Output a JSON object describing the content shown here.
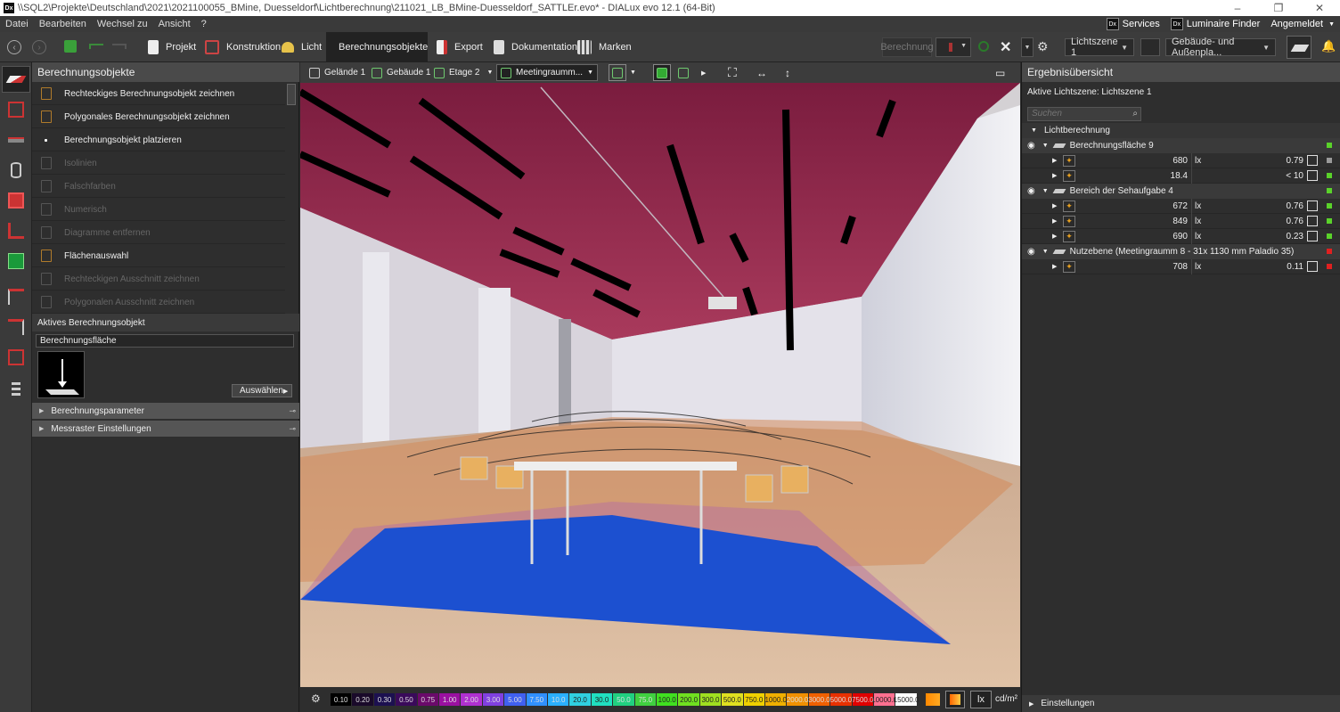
{
  "window": {
    "title": "\\\\SQL2\\Projekte\\Deutschland\\2021\\2021100055_BMine, Duesseldorf\\Lichtberechnung\\211021_LB_BMine-Duesseldorf_SATTLEr.evo* - DIALux evo 12.1  (64-Bit)",
    "app_badge": "Dx",
    "controls": [
      "–",
      "❐",
      "✕"
    ]
  },
  "menu": {
    "items": [
      "Datei",
      "Bearbeiten",
      "Wechsel zu",
      "Ansicht",
      "?"
    ],
    "services": "Services",
    "luminaire_finder": "Luminaire Finder",
    "login": "Angemeldet"
  },
  "toolbar": {
    "tabs": [
      "Projekt",
      "Konstruktion",
      "Licht",
      "Berechnungsobjekte",
      "Export",
      "Dokumentation",
      "Marken"
    ],
    "active_tab": "Berechnungsobjekte",
    "berechnung": "Berechnung",
    "light_scene": "Lichtszene 1",
    "view_select": "Gebäude- und Außenpla..."
  },
  "left_panel": {
    "title": "Berechnungsobjekte",
    "items": [
      {
        "label": "Rechteckiges Berechnungsobjekt zeichnen",
        "enabled": true
      },
      {
        "label": "Polygonales Berechnungsobjekt zeichnen",
        "enabled": true
      },
      {
        "label": "Berechnungsobjekt platzieren",
        "enabled": true
      },
      {
        "label": "Isolinien",
        "enabled": false
      },
      {
        "label": "Falschfarben",
        "enabled": false
      },
      {
        "label": "Numerisch",
        "enabled": false
      },
      {
        "label": "Diagramme entfernen",
        "enabled": false
      },
      {
        "label": "Flächenauswahl",
        "enabled": true
      },
      {
        "label": "Rechteckigen Ausschnitt zeichnen",
        "enabled": false
      },
      {
        "label": "Polygonalen Ausschnitt zeichnen",
        "enabled": false
      }
    ],
    "active_title": "Aktives Berechnungsobjekt",
    "active_name": "Berechnungsfläche",
    "select_button": "Auswählen",
    "sections": [
      "Berechnungsparameter",
      "Messraster Einstellungen"
    ]
  },
  "view_toolbar": {
    "gelaende": "Gelände 1",
    "gebaeude": "Gebäude 1",
    "etage": "Etage 2",
    "room": "Meetingraumm..."
  },
  "legend": {
    "values": [
      "0.10",
      "0.20",
      "0.30",
      "0.50",
      "0.75",
      "1.00",
      "2.00",
      "3.00",
      "5.00",
      "7.50",
      "10.0",
      "20.0",
      "30.0",
      "50.0",
      "75.0",
      "100.0",
      "200.0",
      "300.0",
      "500.0",
      "750.0",
      "1000.0",
      "2000.0",
      "3000.0",
      "5000.0",
      "7500.0",
      "10000.0",
      "15000.0"
    ],
    "colors": [
      "#000000",
      "#1a0a2a",
      "#1c1050",
      "#3a0a5a",
      "#6a0a6a",
      "#9a10a0",
      "#b030d0",
      "#8040e0",
      "#4060f0",
      "#3090ff",
      "#2ab0ff",
      "#30d0e0",
      "#20e0c0",
      "#20d080",
      "#40d040",
      "#40e020",
      "#70e020",
      "#a0e020",
      "#e0e020",
      "#f0d000",
      "#f0b000",
      "#f09000",
      "#f06000",
      "#e83000",
      "#e00000",
      "#ff7090",
      "#ffffff"
    ],
    "unit_lx": "lx",
    "unit_cd": "cd/m²"
  },
  "right_panel": {
    "title": "Ergebnisübersicht",
    "active_scene": "Aktive Lichtszene: Lichtszene 1",
    "search_placeholder": "Suchen",
    "group": "Lichtberechnung",
    "footer": "Einstellungen",
    "objects": [
      {
        "name": "Berechnungsfläche 9",
        "status": "#5ad22a",
        "rows": [
          {
            "value": "680",
            "unit": "lx",
            "ratio": "0.79",
            "status": "#9a9a9a"
          },
          {
            "value": "18.4",
            "unit": "",
            "ratio": "< 10",
            "status": "#5ad22a"
          }
        ]
      },
      {
        "name": "Bereich der Sehaufgabe 4",
        "status": "#5ad22a",
        "rows": [
          {
            "value": "672",
            "unit": "lx",
            "ratio": "0.76",
            "status": "#5ad22a"
          },
          {
            "value": "849",
            "unit": "lx",
            "ratio": "0.76",
            "status": "#5ad22a"
          },
          {
            "value": "690",
            "unit": "lx",
            "ratio": "0.23",
            "status": "#5ad22a"
          }
        ]
      },
      {
        "name": "Nutzebene (Meetingraumm 8 - 31x 1130 mm Paladio 35)",
        "status": "#e02020",
        "rows": [
          {
            "value": "708",
            "unit": "lx",
            "ratio": "0.11",
            "status": "#e02020"
          }
        ]
      }
    ]
  }
}
